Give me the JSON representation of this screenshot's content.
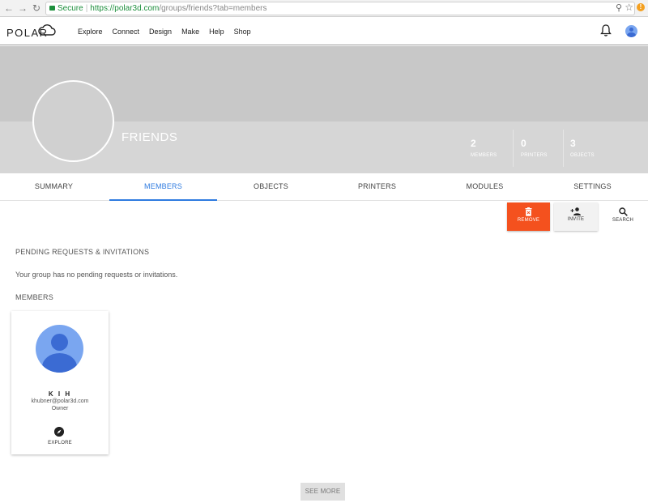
{
  "browser": {
    "secure_label": "Secure",
    "separator": "|",
    "url_host": "https://polar3d.com",
    "url_path": "/groups/friends?tab=members"
  },
  "header": {
    "logo": "POLAR",
    "nav": [
      "Explore",
      "Connect",
      "Design",
      "Make",
      "Help",
      "Shop"
    ]
  },
  "group": {
    "name": "FRIENDS",
    "stats": [
      {
        "value": "2",
        "label": "MEMBERS"
      },
      {
        "value": "0",
        "label": "PRINTERS"
      },
      {
        "value": "3",
        "label": "OBJECTS"
      }
    ]
  },
  "tabs": [
    "SUMMARY",
    "MEMBERS",
    "OBJECTS",
    "PRINTERS",
    "MODULES",
    "SETTINGS"
  ],
  "active_tab": "MEMBERS",
  "actions": {
    "remove": "REMOVE",
    "invite": "INVITE",
    "search": "SEARCH"
  },
  "pending": {
    "title": "PENDING REQUESTS & INVITATIONS",
    "empty_text": "Your group has no pending requests or invitations."
  },
  "members": {
    "title": "MEMBERS",
    "list": [
      {
        "name": "K I H",
        "email": "khubner@polar3d.com",
        "role": "Owner",
        "action": "EXPLORE"
      }
    ],
    "see_more": "SEE MORE"
  },
  "colors": {
    "accent": "#2f7be0",
    "remove": "#f4511e",
    "secure": "#1d8f3c"
  }
}
